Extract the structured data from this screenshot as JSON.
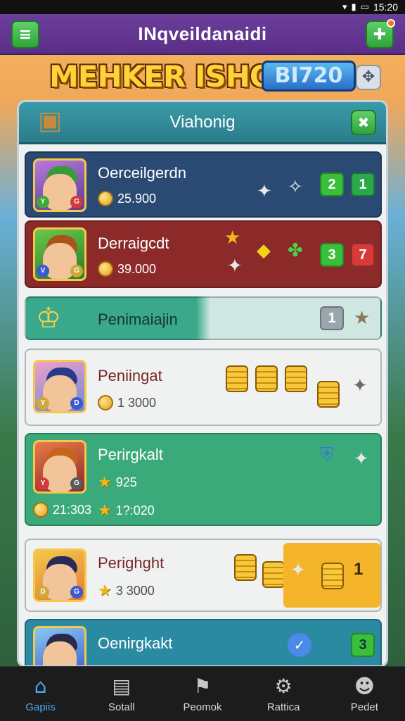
{
  "status_bar": {
    "time": "15:20"
  },
  "app_bar": {
    "title": "INqveildanaidi"
  },
  "banner": {
    "logo_text": "MEHKER ISHOOI",
    "badge_text": "BI720"
  },
  "panel": {
    "title": "Viahonig",
    "rows": [
      {
        "name": "Oerceilgerdn",
        "score": "25.900",
        "badges": [
          "2",
          "1"
        ],
        "bg": "#2a4a74",
        "text_color": "#ffffff"
      },
      {
        "name": "Derraigcdt",
        "score": "39.000",
        "badges": [
          "3",
          "7"
        ],
        "bg": "#8c2a2a",
        "text_color": "#ffffff"
      },
      {
        "name": "Penimaiajin",
        "badge": "1",
        "bg": "#3aa88a",
        "text_color": "#17343a"
      },
      {
        "name": "Peniingat",
        "score": "1 3000",
        "bg": "#f0f2f2",
        "text_color": "#7a2626"
      },
      {
        "name": "Perirgkalt",
        "score": "925",
        "score2": "21:303",
        "score3": "1?:020",
        "bg": "#3aaa7a",
        "text_color": "#ffffff"
      },
      {
        "name": "Perighght",
        "score": "3 3000",
        "badge": "1",
        "bg": "#f0f2f2",
        "text_color": "#7a2626"
      },
      {
        "name": "Oenirgkakt",
        "badge": "3",
        "bg": "#2a8aa2",
        "text_color": "#ffffff"
      }
    ]
  },
  "bottom_nav": [
    {
      "label": "Gapiis",
      "icon": "home-icon",
      "active": true
    },
    {
      "label": "Sotall",
      "icon": "document-icon",
      "active": false
    },
    {
      "label": "Peomok",
      "icon": "flag-icon",
      "active": false
    },
    {
      "label": "Rattica",
      "icon": "gear-icon",
      "active": false
    },
    {
      "label": "Pedet",
      "icon": "user-icon",
      "active": false
    }
  ],
  "colors": {
    "accent": "#4aa8f0",
    "appbar": "#5a2e88",
    "green_button": "#2fa33a"
  }
}
